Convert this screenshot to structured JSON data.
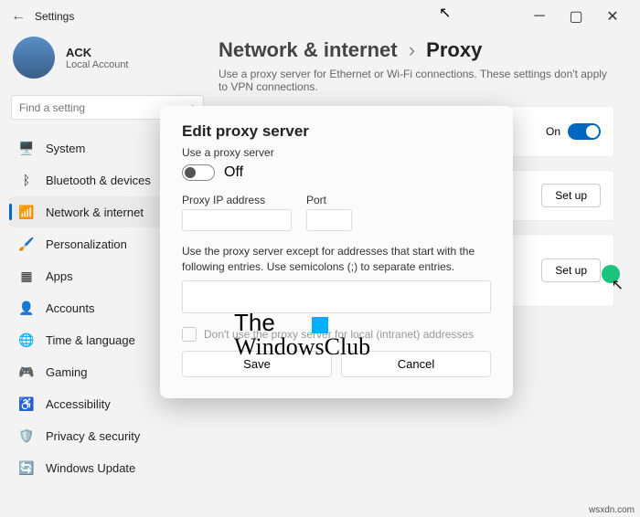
{
  "titlebar": {
    "title": "Settings"
  },
  "profile": {
    "name": "ACK",
    "type": "Local Account"
  },
  "search": {
    "placeholder": "Find a setting"
  },
  "nav": [
    {
      "icon": "🖥️",
      "label": "System"
    },
    {
      "icon": "ᛒ",
      "label": "Bluetooth & devices"
    },
    {
      "icon": "📶",
      "label": "Network & internet",
      "active": true
    },
    {
      "icon": "🖌️",
      "label": "Personalization"
    },
    {
      "icon": "▦",
      "label": "Apps"
    },
    {
      "icon": "👤",
      "label": "Accounts"
    },
    {
      "icon": "🌐",
      "label": "Time & language"
    },
    {
      "icon": "🎮",
      "label": "Gaming"
    },
    {
      "icon": "♿",
      "label": "Accessibility"
    },
    {
      "icon": "🛡️",
      "label": "Privacy & security"
    },
    {
      "icon": "🔄",
      "label": "Windows Update"
    }
  ],
  "breadcrumb": {
    "parent": "Network & internet",
    "current": "Proxy"
  },
  "page_desc": "Use a proxy server for Ethernet or Wi-Fi connections. These settings don't apply to VPN connections.",
  "rows": {
    "toggle_state": "On",
    "setup1": "Set up",
    "setup2": "Set up"
  },
  "dialog": {
    "title": "Edit proxy server",
    "use_label": "Use a proxy server",
    "toggle_state": "Off",
    "ip_label": "Proxy IP address",
    "port_label": "Port",
    "exception_note": "Use the proxy server except for addresses that start with the following entries. Use semicolons (;) to separate entries.",
    "local_check": "Don't use the proxy server for local (intranet) addresses",
    "save": "Save",
    "cancel": "Cancel"
  },
  "watermark": {
    "line1": "The",
    "line2": "WindowsClub"
  },
  "source": "wsxdn.com",
  "icon_colors": {
    "system": "#4a7cbf",
    "bt": "#4a7cbf",
    "net": "#4a7cbf",
    "pers": "#d67b2e",
    "apps": "#4a7cbf",
    "acc": "#4a7cbf",
    "time": "#4a7cbf",
    "game": "#4a7cbf",
    "access": "#4a7cbf",
    "priv": "#4a7cbf",
    "wu": "#d67b2e"
  }
}
